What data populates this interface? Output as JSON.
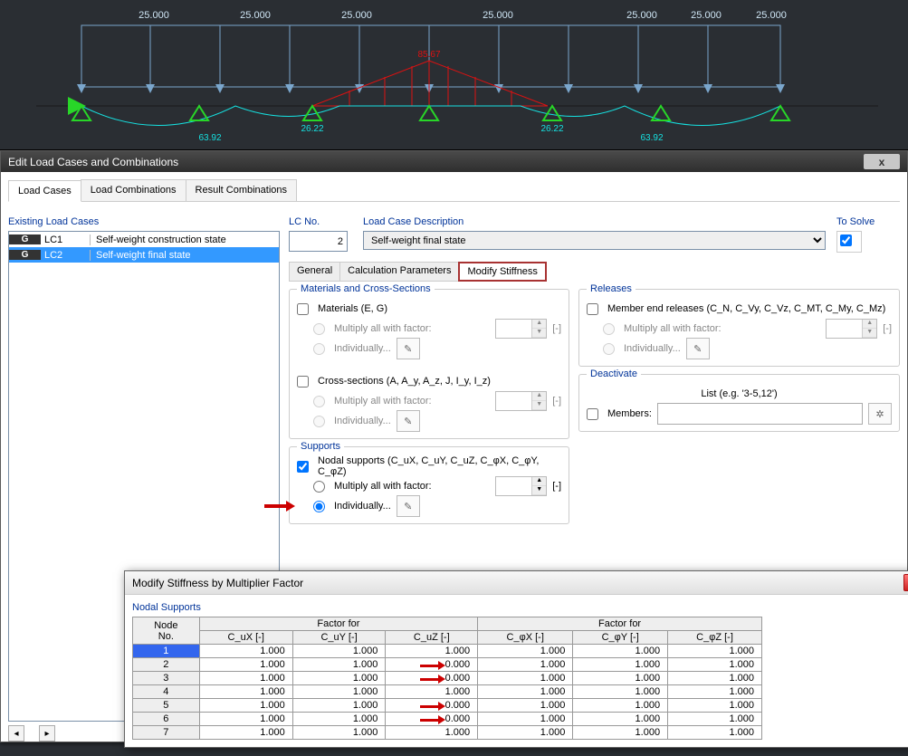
{
  "canvas": {
    "load_labels": [
      "25.000",
      "25.000",
      "25.000",
      "25.000",
      "25.000",
      "25.000",
      "25.000"
    ],
    "peak_label": "85.67",
    "bottom_labels": [
      "63.92",
      "26.22",
      "26.22",
      "63.92"
    ]
  },
  "dialog": {
    "title": "Edit Load Cases and Combinations",
    "close": "x",
    "main_tabs": [
      "Load Cases",
      "Load Combinations",
      "Result Combinations"
    ],
    "left": {
      "title": "Existing Load Cases",
      "rows": [
        {
          "tag": "G",
          "no": "LC1",
          "desc": "Self-weight construction state"
        },
        {
          "tag": "G",
          "no": "LC2",
          "desc": "Self-weight final state"
        }
      ]
    },
    "top": {
      "lc_no_label": "LC No.",
      "lc_no_value": "2",
      "desc_label": "Load Case Description",
      "desc_value": "Self-weight final state",
      "tosolve_label": "To Solve"
    },
    "sub_tabs": [
      "General",
      "Calculation Parameters",
      "Modify Stiffness"
    ],
    "mat": {
      "title": "Materials and Cross-Sections",
      "materials_cb": "Materials (E, G)",
      "mult": "Multiply all with factor:",
      "indiv": "Individually...",
      "unit": "[-]",
      "cross_cb": "Cross-sections (A, A_y, A_z, J, I_y, I_z)"
    },
    "supports": {
      "title": "Supports",
      "nodal_cb": "Nodal supports (C_uX, C_uY, C_uZ, C_φX, C_φY, C_φZ)",
      "mult": "Multiply all with factor:",
      "indiv": "Individually...",
      "unit": "[-]"
    },
    "releases": {
      "title": "Releases",
      "mer_cb": "Member end releases (C_N, C_Vy, C_Vz, C_MT, C_My, C_Mz)",
      "mult": "Multiply all with factor:",
      "indiv": "Individually...",
      "unit": "[-]"
    },
    "deactivate": {
      "title": "Deactivate",
      "list_label": "List (e.g. '3-5,12')",
      "members_cb": "Members:"
    }
  },
  "subdialog": {
    "title": "Modify Stiffness by Multiplier Factor",
    "section": "Nodal Supports",
    "headers": {
      "node": "Node\nNo.",
      "ff1": "Factor for",
      "ff2": "Factor for",
      "cols": [
        "C_uX [-]",
        "C_uY [-]",
        "C_uZ [-]",
        "C_φX [-]",
        "C_φY [-]",
        "C_φZ [-]"
      ]
    },
    "rows": [
      {
        "n": "1",
        "v": [
          "1.000",
          "1.000",
          "1.000",
          "1.000",
          "1.000",
          "1.000"
        ],
        "hl": false
      },
      {
        "n": "2",
        "v": [
          "1.000",
          "1.000",
          "0.000",
          "1.000",
          "1.000",
          "1.000"
        ],
        "hl": true
      },
      {
        "n": "3",
        "v": [
          "1.000",
          "1.000",
          "0.000",
          "1.000",
          "1.000",
          "1.000"
        ],
        "hl": true
      },
      {
        "n": "4",
        "v": [
          "1.000",
          "1.000",
          "1.000",
          "1.000",
          "1.000",
          "1.000"
        ],
        "hl": false
      },
      {
        "n": "5",
        "v": [
          "1.000",
          "1.000",
          "0.000",
          "1.000",
          "1.000",
          "1.000"
        ],
        "hl": true
      },
      {
        "n": "6",
        "v": [
          "1.000",
          "1.000",
          "0.000",
          "1.000",
          "1.000",
          "1.000"
        ],
        "hl": true
      },
      {
        "n": "7",
        "v": [
          "1.000",
          "1.000",
          "1.000",
          "1.000",
          "1.000",
          "1.000"
        ],
        "hl": false
      }
    ]
  }
}
